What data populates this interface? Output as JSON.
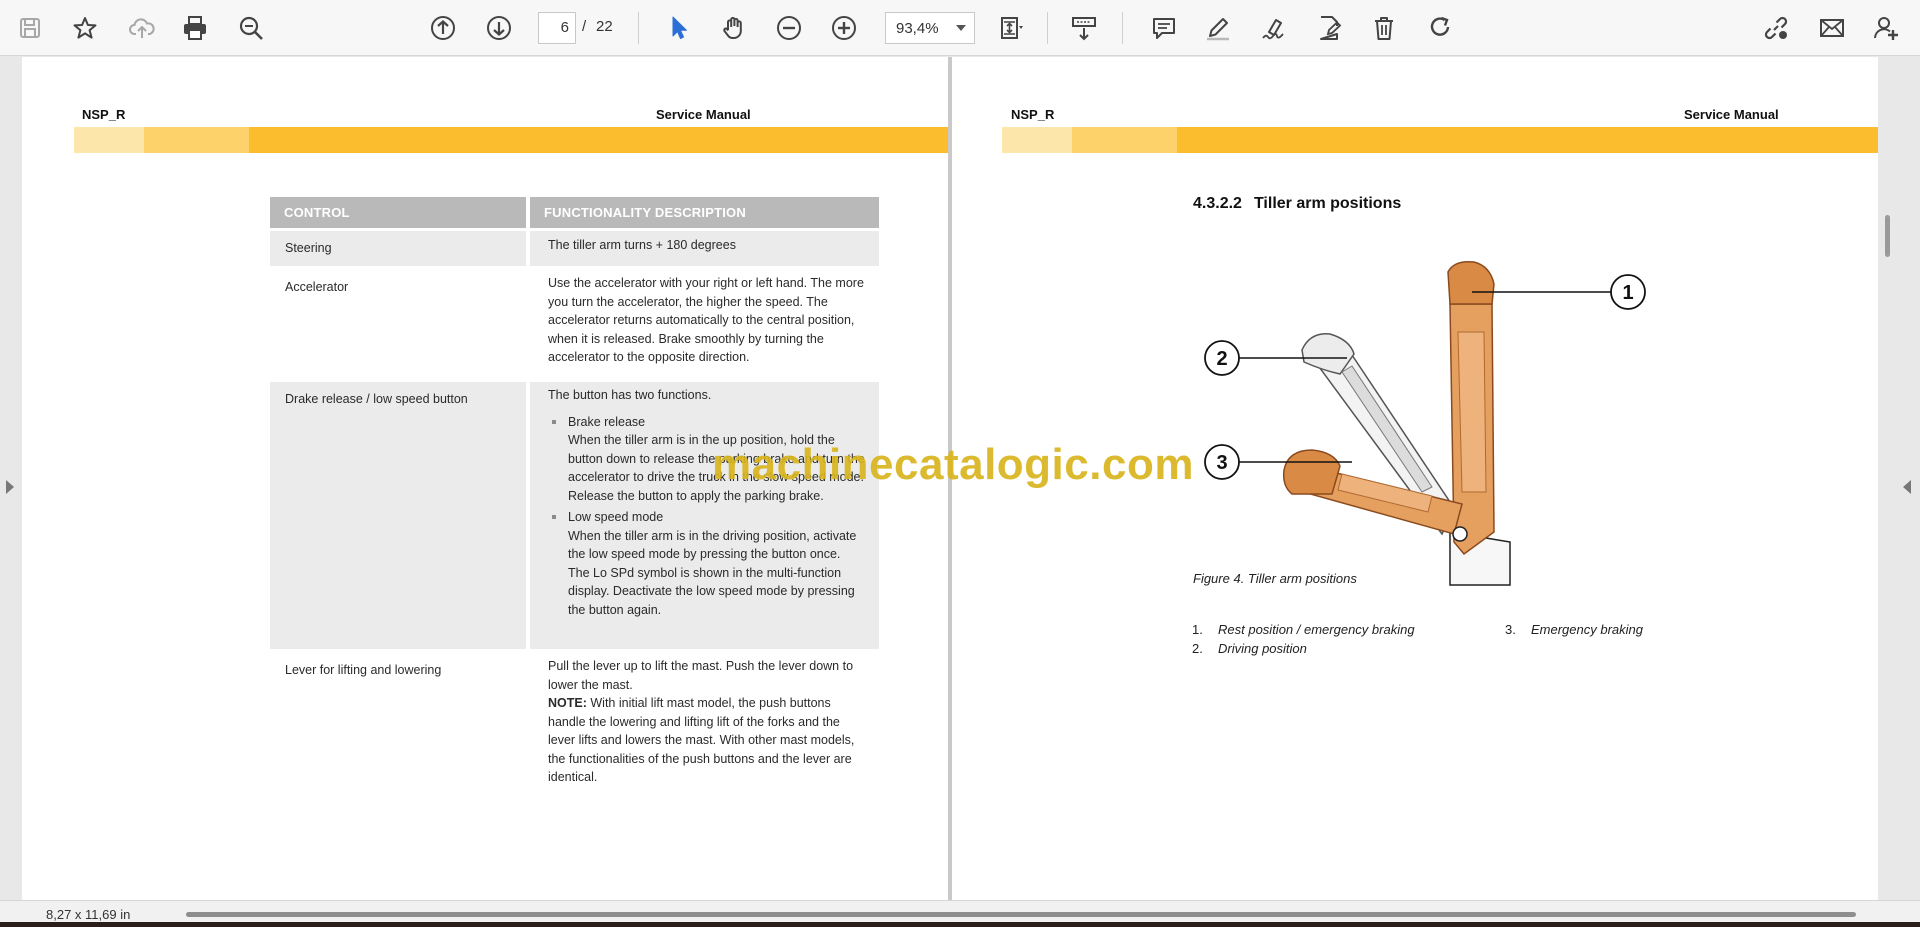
{
  "toolbar": {
    "icons": [
      "save-icon",
      "star-icon",
      "upload-icon",
      "print-icon",
      "zoom-search-icon",
      "arrow-up-circle-icon",
      "arrow-down-circle-icon",
      "pointer-icon",
      "hand-icon",
      "minus-circle-icon",
      "plus-circle-icon",
      "fit-page-icon",
      "scroll-mode-icon",
      "comment-icon",
      "pen-icon",
      "sign-icon",
      "edit-icon",
      "trash-icon",
      "rotate-icon",
      "share-icon",
      "mail-icon",
      "add-user-icon"
    ],
    "current_page": "6",
    "page_separator": "/",
    "total_pages": "22",
    "zoom": "93,4%",
    "accent_color": "#2b6fd6"
  },
  "left_page": {
    "header_left": "NSP_R",
    "header_right": "Service Manual",
    "band_color": "#fbbd2e",
    "table": {
      "headers": [
        "CONTROL",
        "FUNCTIONALITY DESCRIPTION"
      ],
      "rows": [
        {
          "control": "Steering",
          "desc": "The tiller arm turns + 180 degrees"
        },
        {
          "control": "Accelerator",
          "desc": "Use the accelerator with your right or left hand. The more you turn the accelerator, the higher the speed. The accelerator returns automatically to the central position, when it is released. Brake smoothly by turning the accelerator to the opposite direction."
        },
        {
          "control": "Drake release / low speed button",
          "intro": "The button has two functions.",
          "bullets": [
            {
              "title": "Brake release",
              "body": "When the tiller arm is in the up position, hold the button down to release the parking brake and turn the accelerator to drive the truck in the slow speed mode. Release the button to apply the parking brake."
            },
            {
              "title": "Low speed mode",
              "body": "When the tiller arm is in the driving position, activate the low speed mode by pressing the button once. The Lo SPd symbol is shown in the multi-function display. Deactivate the low speed mode by pressing the button again."
            }
          ]
        },
        {
          "control": "Lever for lifting and lowering",
          "desc": "Pull the lever up to lift the mast. Push the lever down to lower the mast.",
          "note_label": "NOTE:",
          "note": "With initial lift mast model, the push buttons handle the lowering and lifting lift of the forks and the lever lifts and lowers the mast. With other mast models, the functionalities of the push buttons and the lever are identical."
        }
      ]
    }
  },
  "right_page": {
    "header_left": "NSP_R",
    "header_right": "Service Manual",
    "section_number": "4.3.2.2",
    "section_title": "Tiller arm positions",
    "callouts": [
      "1",
      "2",
      "3"
    ],
    "tiller_color": "#e5a060",
    "figure_caption": "Figure 4. Tiller arm positions",
    "legend": [
      {
        "num": "1.",
        "text": "Rest position / emergency braking"
      },
      {
        "num": "2.",
        "text": "Driving position"
      },
      {
        "num": "3.",
        "text": "Emergency braking"
      }
    ]
  },
  "watermark": "machinecatalogic.com",
  "status": {
    "page_size": "8,27 x 11,69 in"
  }
}
